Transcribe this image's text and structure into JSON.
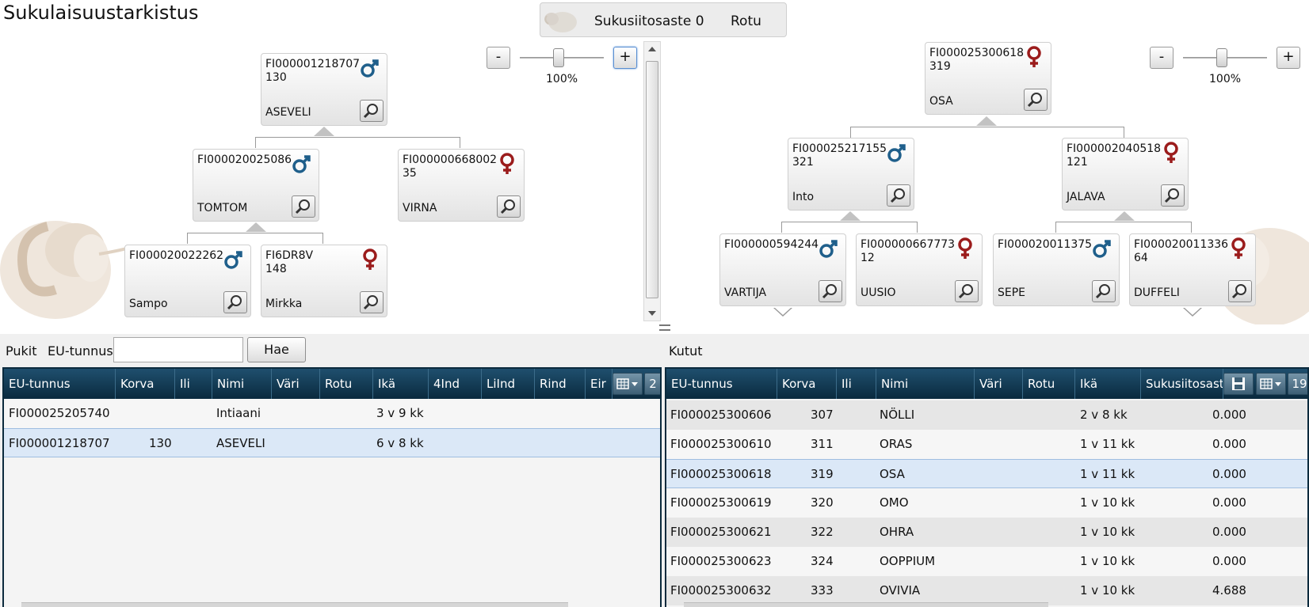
{
  "app": {
    "title": "Sukulaisuustarkistus"
  },
  "topbar": {
    "inbreeding_label": "Sukusiitosaste 0",
    "breed_label": "Rotu"
  },
  "left_pedigree": {
    "zoom": {
      "minus": "-",
      "plus": "+",
      "percent": "100%"
    },
    "root": {
      "eu": "FI000001218707",
      "korva": "130",
      "name": "ASEVELI",
      "sex": "male"
    },
    "sire": {
      "eu": "FI000020025086",
      "korva": "",
      "name": "TOMTOM",
      "sex": "male"
    },
    "dam": {
      "eu": "FI000000668002",
      "korva": "35",
      "name": "VIRNA",
      "sex": "female"
    },
    "sire_sire": {
      "eu": "FI000020022262",
      "korva": "",
      "name": "Sampo",
      "sex": "male"
    },
    "sire_dam": {
      "eu": "FI6DR8V",
      "korva": "148",
      "name": "Mirkka",
      "sex": "female"
    }
  },
  "right_pedigree": {
    "zoom": {
      "minus": "-",
      "plus": "+",
      "percent": "100%"
    },
    "root": {
      "eu": "FI000025300618",
      "korva": "319",
      "name": "OSA",
      "sex": "female"
    },
    "sire": {
      "eu": "FI000025217155",
      "korva": "321",
      "name": "Into",
      "sex": "male"
    },
    "dam": {
      "eu": "FI000002040518",
      "korva": "121",
      "name": "JALAVA",
      "sex": "female"
    },
    "sire_sire": {
      "eu": "FI000000594244",
      "korva": "",
      "name": "VARTIJA",
      "sex": "male"
    },
    "sire_dam": {
      "eu": "FI000000667773",
      "korva": "12",
      "name": "UUSIO",
      "sex": "female"
    },
    "dam_sire": {
      "eu": "FI000020011375",
      "korva": "",
      "name": "SEPE",
      "sex": "male"
    },
    "dam_dam": {
      "eu": "FI000020011336",
      "korva": "64",
      "name": "DUFFELI",
      "sex": "female"
    }
  },
  "rams": {
    "label": "Pukit",
    "eu_label": "EU-tunnus",
    "eu_value": "",
    "search_label": "Hae",
    "columns": [
      "EU-tunnus",
      "Korva",
      "Ili",
      "Nimi",
      "Väri",
      "Rotu",
      "Ikä",
      "4Ind",
      "LiInd",
      "Rind",
      "Eir"
    ],
    "count": "2",
    "rows": [
      {
        "eu": "FI000025205740",
        "korva": "",
        "ili": "",
        "nimi": "Intiaani",
        "vari": "",
        "rotu": "",
        "ika": "3 v 9 kk",
        "selected": false
      },
      {
        "eu": "FI000001218707",
        "korva": "130",
        "ili": "",
        "nimi": "ASEVELI",
        "vari": "",
        "rotu": "",
        "ika": "6 v 8 kk",
        "selected": true
      }
    ]
  },
  "ewes": {
    "label": "Kutut",
    "columns": [
      "EU-tunnus",
      "Korva",
      "Ili",
      "Nimi",
      "Väri",
      "Rotu",
      "Ikä",
      "Sukusiitosast"
    ],
    "count": "19",
    "rows": [
      {
        "eu": "FI000025300606",
        "korva": "307",
        "nimi": "NÖLLI",
        "ika": "2 v 8 kk",
        "ss": "0.000",
        "selected": false
      },
      {
        "eu": "FI000025300610",
        "korva": "311",
        "nimi": "ORAS",
        "ika": "1 v 11 kk",
        "ss": "0.000",
        "selected": false
      },
      {
        "eu": "FI000025300618",
        "korva": "319",
        "nimi": "OSA",
        "ika": "1 v 11 kk",
        "ss": "0.000",
        "selected": true
      },
      {
        "eu": "FI000025300619",
        "korva": "320",
        "nimi": "OMO",
        "ika": "1 v 10 kk",
        "ss": "0.000",
        "selected": false
      },
      {
        "eu": "FI000025300621",
        "korva": "322",
        "nimi": "OHRA",
        "ika": "1 v 10 kk",
        "ss": "0.000",
        "selected": false
      },
      {
        "eu": "FI000025300623",
        "korva": "324",
        "nimi": "OOPPIUM",
        "ika": "1 v 10 kk",
        "ss": "0.000",
        "selected": false
      },
      {
        "eu": "FI000025300632",
        "korva": "333",
        "nimi": "OVIVIA",
        "ika": "1 v 10 kk",
        "ss": "4.688",
        "selected": false
      }
    ]
  },
  "colors": {
    "male": "#1f5f8b",
    "female": "#9b1c1c",
    "header": "#0a2a3e",
    "selected_row": "#dbe8f7"
  }
}
